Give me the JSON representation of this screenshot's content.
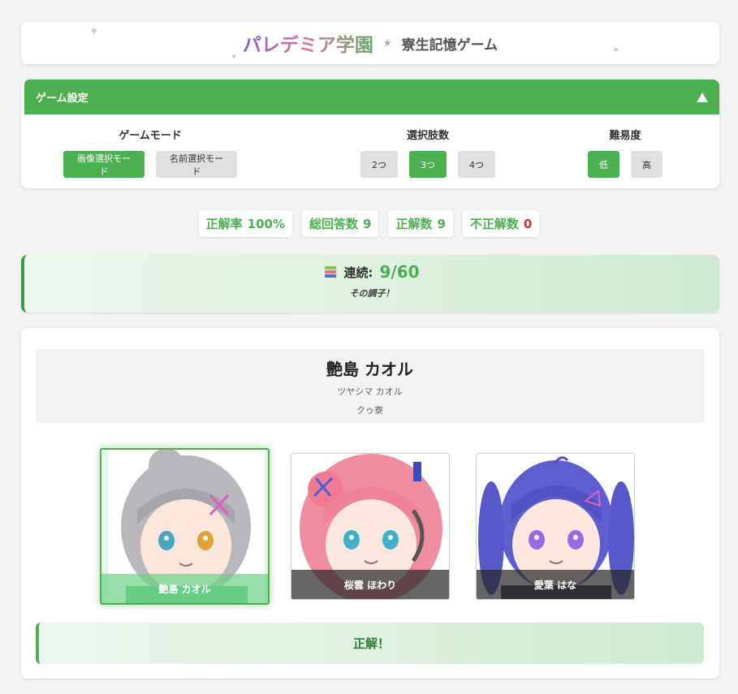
{
  "header": {
    "brand": "パレデミア学園",
    "separator": "★",
    "subtitle": "寮生記憶ゲーム"
  },
  "settings": {
    "title": "ゲーム設定",
    "groups": [
      {
        "label": "ゲームモード",
        "options": [
          "画像選択モード",
          "名前選択モード"
        ],
        "selected": "画像選択モード"
      },
      {
        "label": "選択肢数",
        "options": [
          "2つ",
          "3つ",
          "4つ"
        ],
        "selected": "3つ"
      },
      {
        "label": "難易度",
        "options": [
          "低",
          "高"
        ],
        "selected": "低"
      }
    ]
  },
  "stats": {
    "accuracy_label": "正解率",
    "accuracy_value": "100%",
    "total_label": "総回答数",
    "total_value": "9",
    "correct_label": "正解数",
    "correct_value": "9",
    "wrong_label": "不正解数",
    "wrong_value": "0"
  },
  "streak": {
    "label": "連続:",
    "value": "9/60",
    "message": "その調子！"
  },
  "question": {
    "name": "艶島 カオル",
    "reading": "ツヤシマ カオル",
    "dorm": "クゥ寮"
  },
  "choices": [
    {
      "name": "艶島 カオル",
      "hair": "#b8b8bc",
      "eye": "#4aa6c0",
      "correct": true
    },
    {
      "name": "桜雲 ほわり",
      "hair": "#f08ca0",
      "eye": "#3fb0c8",
      "correct": false
    },
    {
      "name": "愛葉 はな",
      "hair": "#5e5ed0",
      "eye": "#9a6ae0",
      "correct": false
    }
  ],
  "result": {
    "text": "正解！"
  },
  "colors": {
    "accent": "#4caf50",
    "error": "#d32f2f"
  },
  "icons": {
    "collapse": "triangle-up-icon",
    "streak": "books-icon"
  }
}
